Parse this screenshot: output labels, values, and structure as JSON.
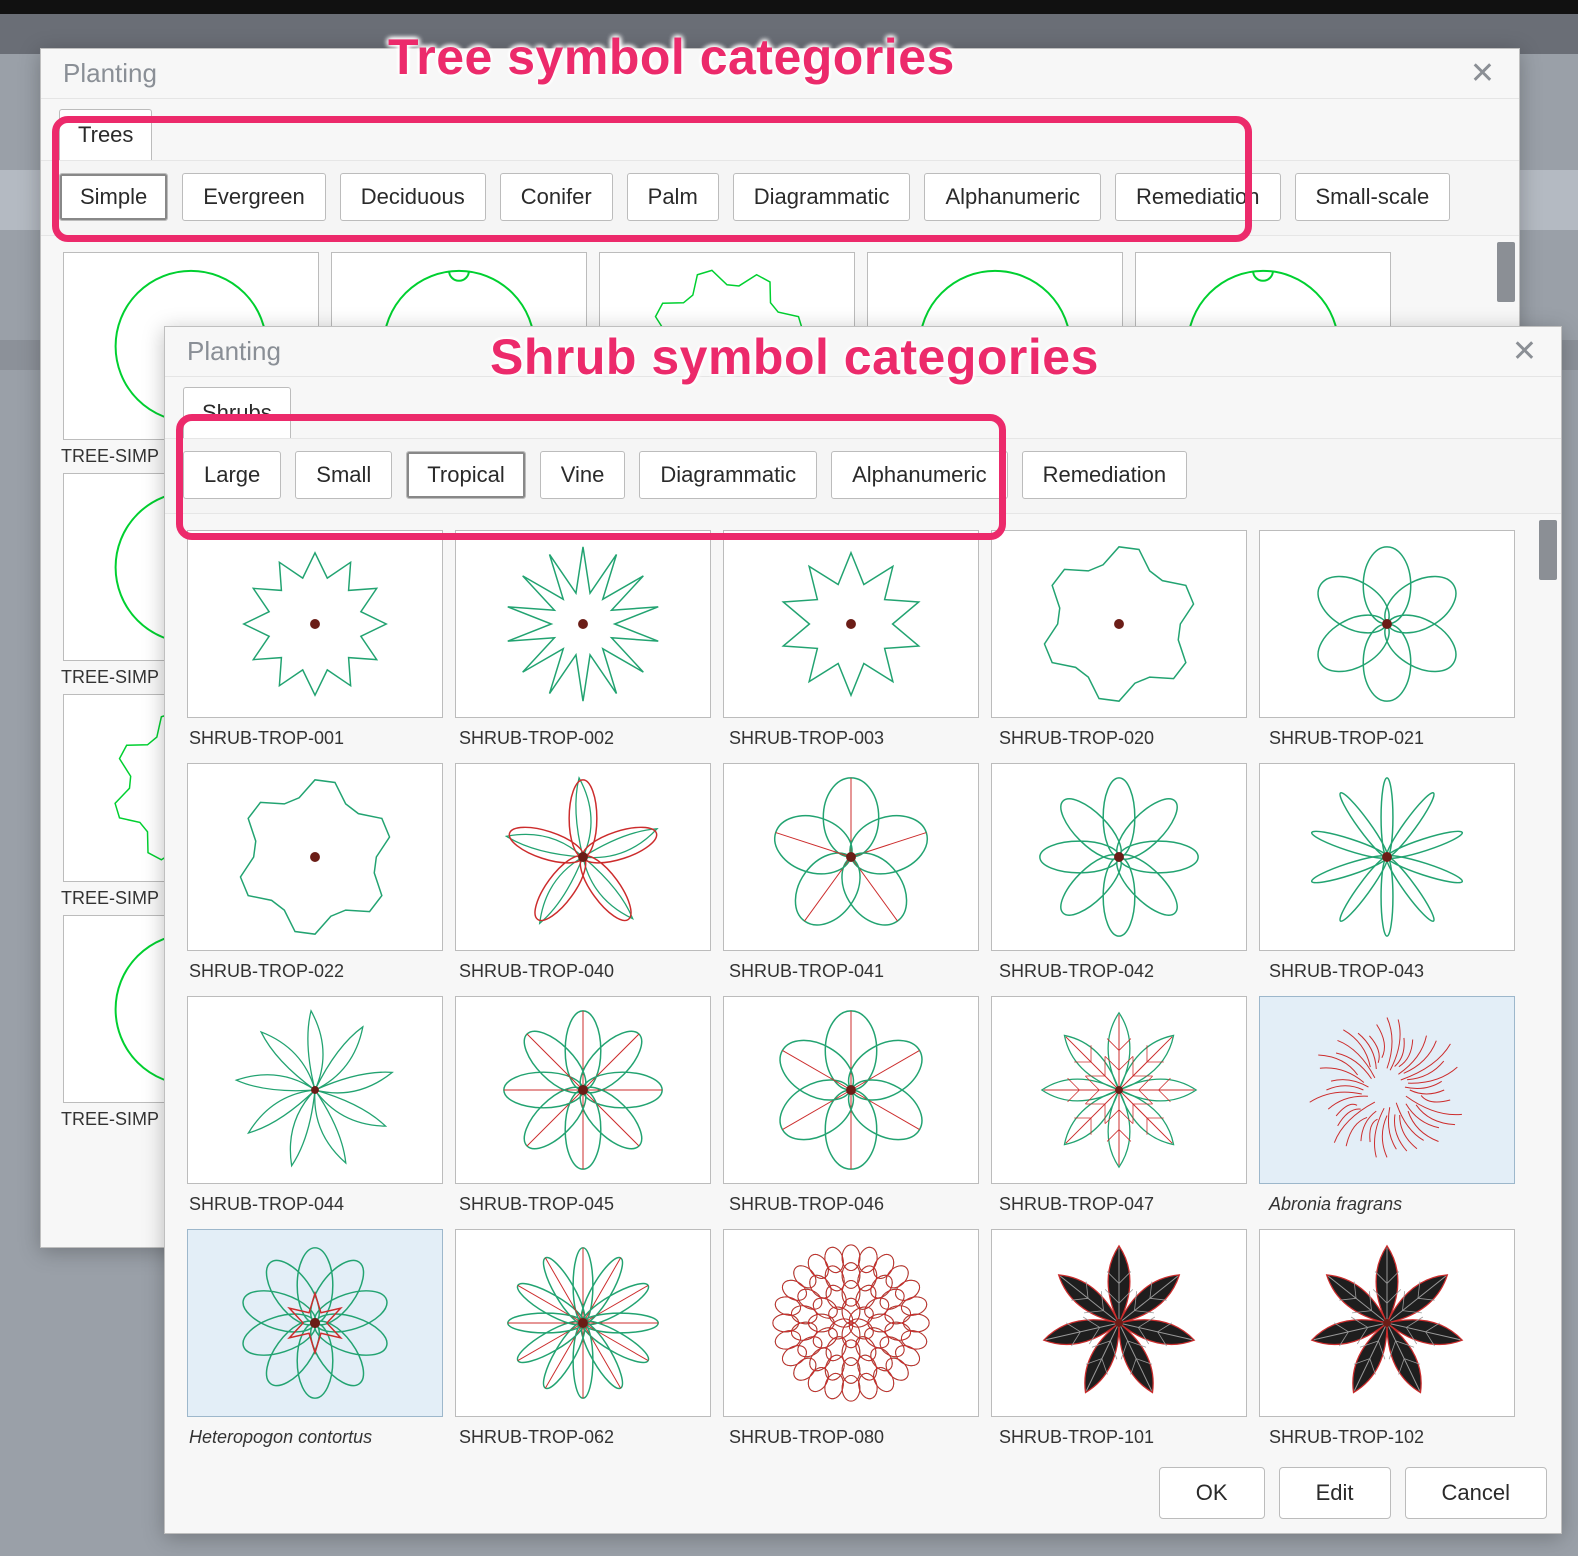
{
  "annotations": {
    "trees_label": "Tree symbol categories",
    "shrubs_label": "Shrub symbol categories"
  },
  "tree_dialog": {
    "title": "Planting",
    "tab": "Trees",
    "categories": [
      "Simple",
      "Evergreen",
      "Deciduous",
      "Conifer",
      "Palm",
      "Diagrammatic",
      "Alphanumeric",
      "Remediation",
      "Small-scale"
    ],
    "selected_category_index": 0,
    "visible_labels": [
      "TREE-SIMP",
      "TREE-SIMP",
      "TREE-SIMP",
      "TREE-SIMP"
    ]
  },
  "shrub_dialog": {
    "title": "Planting",
    "tab": "Shrubs",
    "categories": [
      "Large",
      "Small",
      "Tropical",
      "Vine",
      "Diagrammatic",
      "Alphanumeric",
      "Remediation"
    ],
    "selected_category_index": 2,
    "items": [
      {
        "label": "SHRUB-TROP-001",
        "svg": "trop1"
      },
      {
        "label": "SHRUB-TROP-002",
        "svg": "trop2"
      },
      {
        "label": "SHRUB-TROP-003",
        "svg": "trop3"
      },
      {
        "label": "SHRUB-TROP-020",
        "svg": "trop4"
      },
      {
        "label": "SHRUB-TROP-021",
        "svg": "trop5"
      },
      {
        "label": "SHRUB-TROP-022",
        "svg": "trop6"
      },
      {
        "label": "SHRUB-TROP-040",
        "svg": "trop7"
      },
      {
        "label": "SHRUB-TROP-041",
        "svg": "trop8"
      },
      {
        "label": "SHRUB-TROP-042",
        "svg": "trop9"
      },
      {
        "label": "SHRUB-TROP-043",
        "svg": "trop10"
      },
      {
        "label": "SHRUB-TROP-044",
        "svg": "trop11"
      },
      {
        "label": "SHRUB-TROP-045",
        "svg": "trop12"
      },
      {
        "label": "SHRUB-TROP-046",
        "svg": "trop13"
      },
      {
        "label": "SHRUB-TROP-047",
        "svg": "trop14"
      },
      {
        "label": "Abronia fragrans",
        "svg": "trop15",
        "italic": true,
        "species": true
      },
      {
        "label": "Heteropogon contortus",
        "svg": "trop16",
        "italic": true,
        "species": true
      },
      {
        "label": "SHRUB-TROP-062",
        "svg": "trop17"
      },
      {
        "label": "SHRUB-TROP-080",
        "svg": "trop18"
      },
      {
        "label": "SHRUB-TROP-101",
        "svg": "trop19"
      },
      {
        "label": "SHRUB-TROP-102",
        "svg": "trop20"
      }
    ],
    "footer": {
      "ok": "OK",
      "edit": "Edit",
      "cancel": "Cancel"
    }
  },
  "colors": {
    "annotation": "#ec2a6b",
    "plant_outline": "#22a371",
    "accent_red": "#cc2c2c",
    "center_dot": "#6b1d17"
  }
}
